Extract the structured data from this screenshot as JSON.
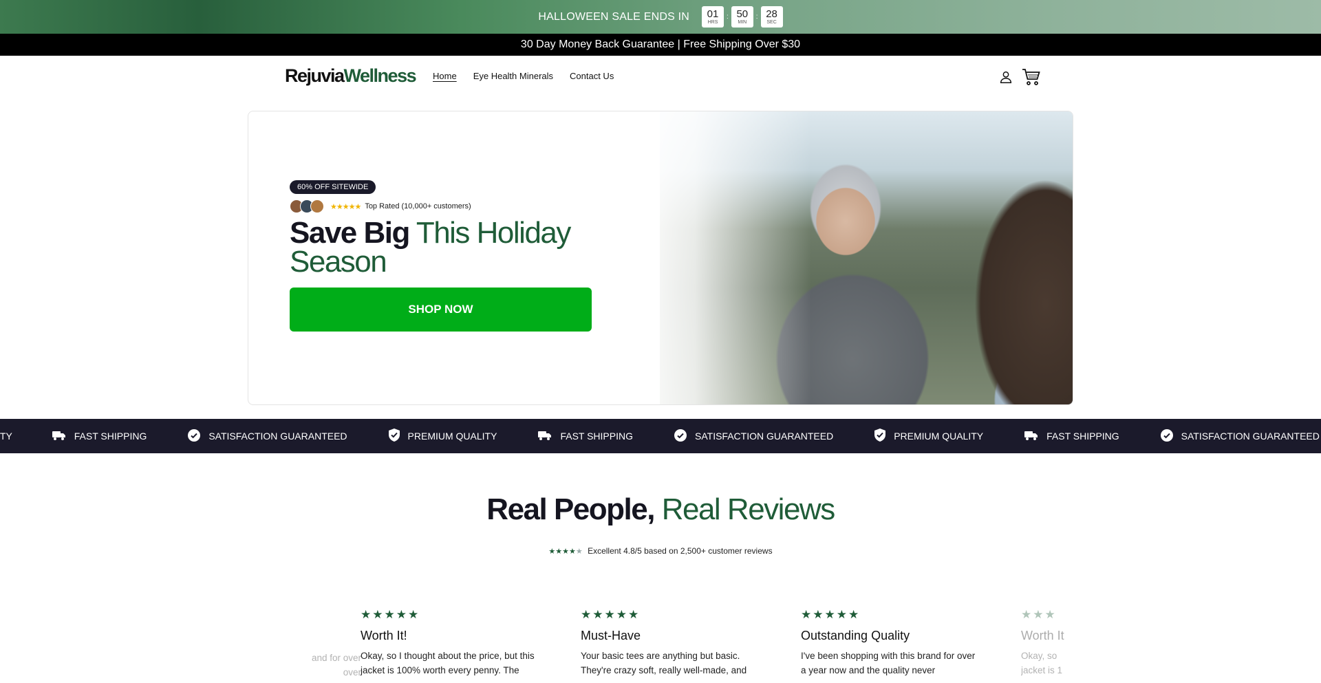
{
  "topbar": {
    "text": "HALLOWEEN SALE ENDS IN",
    "countdown": [
      {
        "value": "01",
        "label": "HRS"
      },
      {
        "value": "50",
        "label": "MIN"
      },
      {
        "value": "28",
        "label": "SEC"
      }
    ]
  },
  "announcement": "30 Day Money Back Guarantee | Free Shipping Over $30",
  "header": {
    "logo_part1": "Rejuvia",
    "logo_part2": "Wellness",
    "nav": [
      "Home",
      "Eye Health Minerals",
      "Contact Us"
    ],
    "icons": [
      "account-icon",
      "cart-icon"
    ]
  },
  "hero": {
    "badge": "60% OFF SITEWIDE",
    "stars": "★★★★★",
    "rating_text": "Top Rated (10,000+ customers)",
    "title_bold": "Save Big",
    "title_green_1": "This Holiday",
    "title_green_2": "Season",
    "cta": "SHOP NOW"
  },
  "marquee": {
    "items": [
      {
        "icon": "truck-icon",
        "label": "FAST SHIPPING"
      },
      {
        "icon": "check-circle-icon",
        "label": "SATISFACTION GUARANTEED"
      },
      {
        "icon": "shield-check-icon",
        "label": "PREMIUM QUALITY"
      },
      {
        "icon": "truck-icon",
        "label": "FAST SHIPPING"
      },
      {
        "icon": "check-circle-icon",
        "label": "SATISFACTION GUARANTEED"
      },
      {
        "icon": "shield-check-icon",
        "label": "PREMIUM QUALITY"
      },
      {
        "icon": "truck-icon",
        "label": "FAST SHIPPING"
      },
      {
        "icon": "check-circle-icon",
        "label": "SATISFACTION GUARANTEED"
      }
    ],
    "partial_left": "ITY"
  },
  "reviews": {
    "title_bold": "Real People,",
    "title_green": "Real Reviews",
    "stars": "★★★★",
    "star_dim": "★",
    "summary": "Excellent 4.8/5 based on 2,500+ customer reviews",
    "cards": [
      {
        "stars": "★★★★★",
        "title": "",
        "body": "and for over\nover"
      },
      {
        "stars": "★★★★★",
        "title": "Worth It!",
        "body": "Okay, so I thought about the price, but this jacket is 100% worth every penny. The"
      },
      {
        "stars": "★★★★★",
        "title": "Must-Have",
        "body": "Your basic tees are anything but basic. They're crazy soft, really well-made, and"
      },
      {
        "stars": "★★★★★",
        "title": "Outstanding Quality",
        "body": "I've been shopping with this brand for over a year now and the quality never"
      },
      {
        "stars": "★★★",
        "title": "Worth It",
        "body": "Okay, so\njacket is 1"
      }
    ]
  }
}
